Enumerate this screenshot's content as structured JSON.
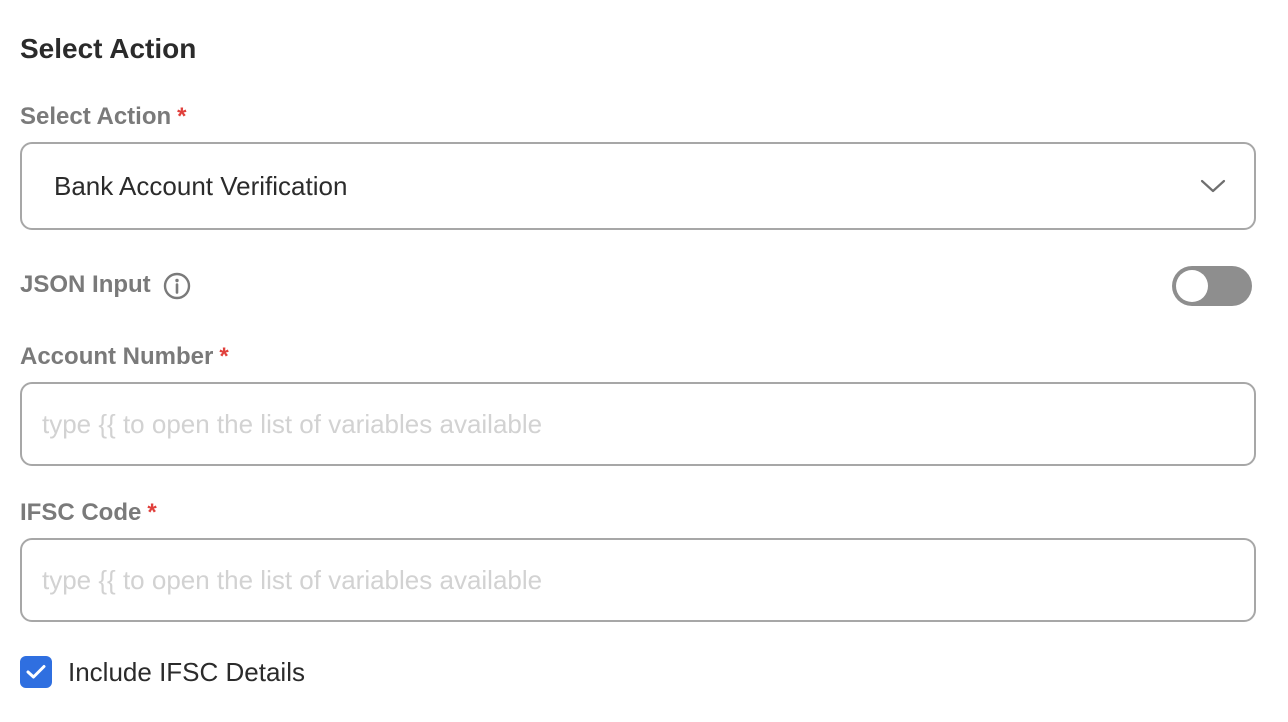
{
  "section": {
    "title": "Select Action"
  },
  "select_action": {
    "label": "Select Action",
    "required_mark": "*",
    "value": "Bank Account Verification",
    "icon": "chevron-down-icon"
  },
  "json_input": {
    "label": "JSON Input",
    "info_icon": "info-icon",
    "enabled": false
  },
  "account_number": {
    "label": "Account Number",
    "required_mark": "*",
    "value": "",
    "placeholder": "type {{ to open the list of variables available"
  },
  "ifsc_code": {
    "label": "IFSC Code",
    "required_mark": "*",
    "value": "",
    "placeholder": "type {{ to open the list of variables available"
  },
  "include_ifsc": {
    "label": "Include IFSC Details",
    "checked": true,
    "icon": "checkmark-icon"
  },
  "colors": {
    "accent": "#2f6fe0",
    "required": "#e0403c",
    "label": "#7a7a7a",
    "border": "#a7a7a7",
    "toggle_off": "#8e8e8e",
    "placeholder": "#d2d2d2"
  }
}
